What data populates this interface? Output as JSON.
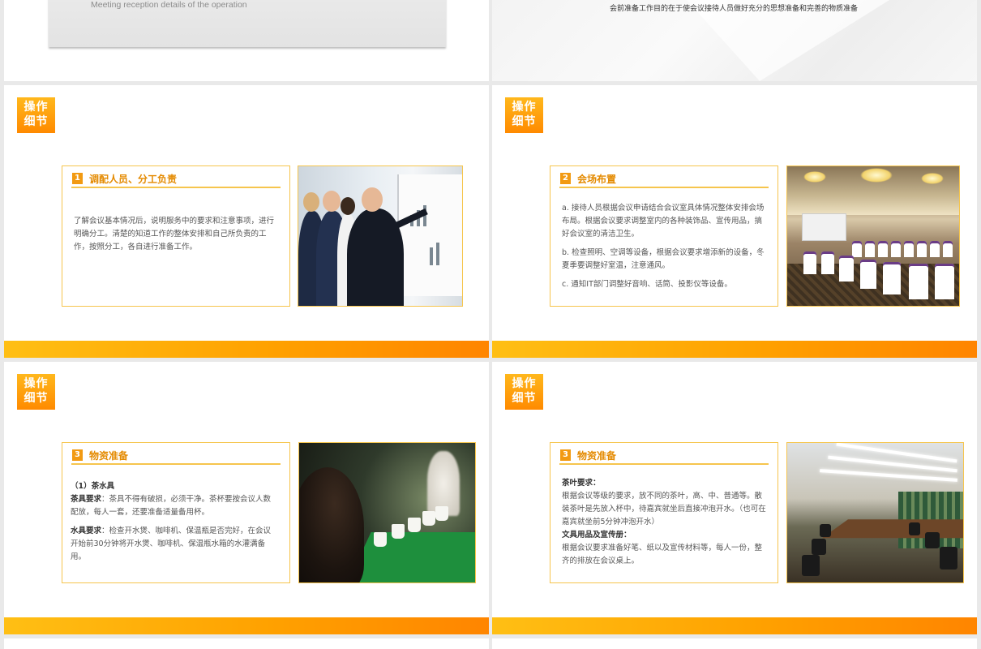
{
  "top_left": {
    "subtitle_en": "Meeting reception details of the operation"
  },
  "top_right": {
    "intro_text": "会前准备工作目的在于使会议接待人员做好充分的思想准备和完善的物质准备"
  },
  "badge": {
    "line1": "操作",
    "line2": "细节"
  },
  "slides": [
    {
      "number": "1",
      "title": "调配人员、分工负责",
      "paragraphs": [
        "了解会议基本情况后，说明服务中的要求和注意事项，进行明确分工。清楚的知道工作的整体安排和自己所负责的工作，按照分工，各自进行准备工作。"
      ]
    },
    {
      "number": "2",
      "title": "会场布置",
      "paragraphs": [
        "a. 接待人员根据会议申请结合会议室具体情况整体安排会场布局。根据会议要求调整室内的各种装饰品、宣传用品，搞好会议室的清洁卫生。",
        "b. 检查照明、空调等设备，根据会议要求增添新的设备，冬夏季要调整好室温，注意通风。",
        "c. 通知IT部门调整好音响、话筒、投影仪等设备。"
      ]
    },
    {
      "number": "3",
      "title": "物资准备",
      "subheading": "（1）茶水具",
      "items": [
        {
          "label": "茶具要求",
          "text": "：茶具不得有破损，必须干净。茶杯要按会议人数配放，每人一套，还要准备适量备用杯。"
        },
        {
          "label": "水具要求",
          "text": "：检查开水煲、咖啡机、保温瓶是否完好，在会议开始前30分钟将开水煲、咖啡机、保温瓶水箱的水灌满备用。"
        }
      ]
    },
    {
      "number": "3",
      "title": "物资准备",
      "blocks": [
        {
          "label": "茶叶要求：",
          "text": "根据会议等级的要求，放不同的茶叶，高、中、普通等。散装茶叶是先放入杯中，待嘉宾就坐后直接冲泡开水。（也可在嘉宾就坐前5分钟冲泡开水）"
        },
        {
          "label": "文具用品及宣传册：",
          "text": "根据会议要求准备好笔、纸以及宣传材料等，每人一份，整齐的排放在会议桌上。"
        }
      ]
    }
  ],
  "colors": {
    "accent_orange": "#f29a12",
    "card_border": "#f6c54d",
    "footer_gradient_start": "#ffbf14",
    "footer_gradient_end": "#ff8500"
  }
}
